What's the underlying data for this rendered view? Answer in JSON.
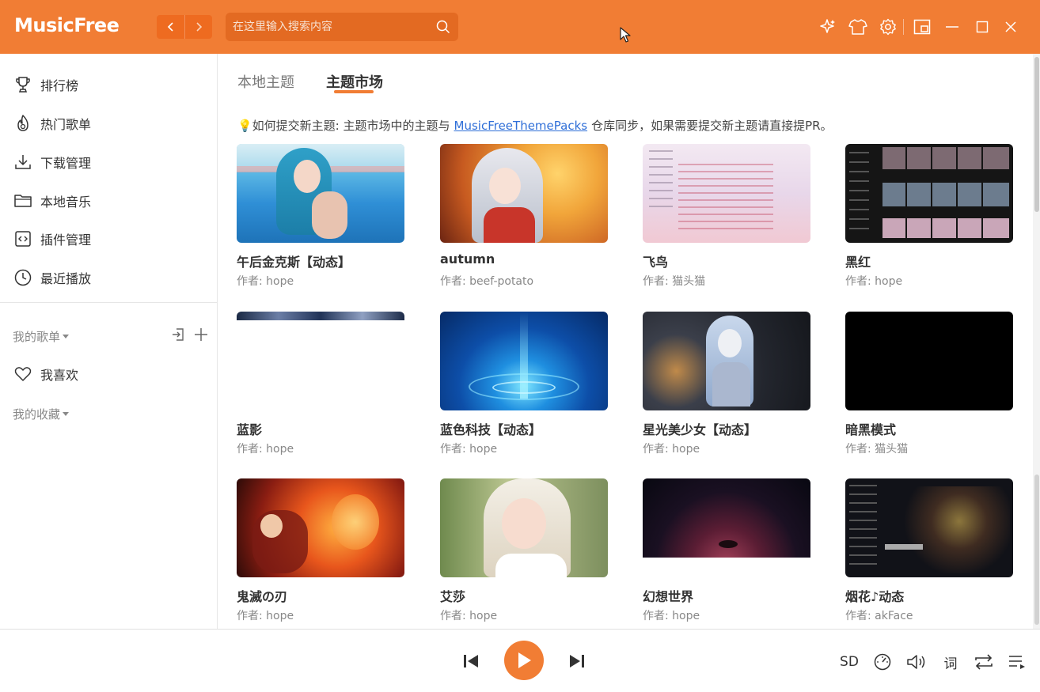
{
  "app": {
    "title": "MusicFree"
  },
  "search": {
    "placeholder": "在这里输入搜索内容"
  },
  "sidebar": {
    "items": [
      {
        "label": "排行榜",
        "icon": "trophy-icon"
      },
      {
        "label": "热门歌单",
        "icon": "fire-icon"
      },
      {
        "label": "下载管理",
        "icon": "download-icon"
      },
      {
        "label": "本地音乐",
        "icon": "folder-icon"
      },
      {
        "label": "插件管理",
        "icon": "plugin-icon"
      },
      {
        "label": "最近播放",
        "icon": "clock-icon"
      }
    ],
    "my_playlists": "我的歌单",
    "favorite": "我喜欢",
    "my_collections": "我的收藏"
  },
  "tabs": [
    {
      "label": "本地主题",
      "active": false
    },
    {
      "label": "主题市场",
      "active": true
    }
  ],
  "notice": {
    "prefix": "💡如何提交新主题: 主题市场中的主题与",
    "link": "MusicFreeThemePacks",
    "suffix": "仓库同步，如果需要提交新主题请直接提PR。"
  },
  "themes": [
    {
      "title": "午后金克斯【动态】",
      "author": "作者: hope"
    },
    {
      "title": "autumn",
      "author": "作者: beef-potato"
    },
    {
      "title": "飞鸟",
      "author": "作者: 猫头猫"
    },
    {
      "title": "黑红",
      "author": "作者: hope"
    },
    {
      "title": "蓝影",
      "author": "作者: hope"
    },
    {
      "title": "蓝色科技【动态】",
      "author": "作者: hope"
    },
    {
      "title": "星光美少女【动态】",
      "author": "作者: hope"
    },
    {
      "title": "暗黑模式",
      "author": "作者: 猫头猫"
    },
    {
      "title": "鬼滅の刃",
      "author": "作者: hope"
    },
    {
      "title": "艾莎",
      "author": "作者: hope"
    },
    {
      "title": "幻想世界",
      "author": "作者: hope"
    },
    {
      "title": "烟花♪动态",
      "author": "作者: akFace"
    }
  ],
  "player": {
    "quality": "SD",
    "lyric": "词"
  },
  "colors": {
    "accent": "#f17d34",
    "link": "#2f6fd8"
  }
}
